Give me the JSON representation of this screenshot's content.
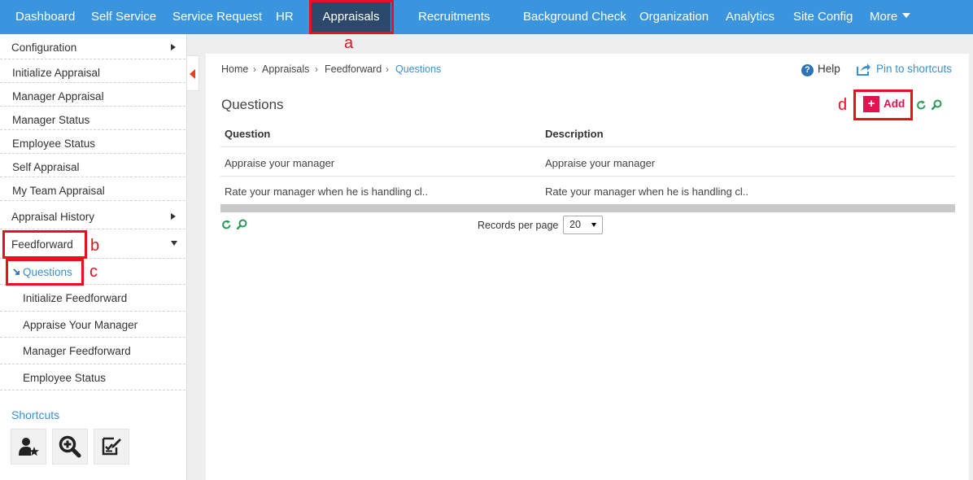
{
  "topnav": {
    "items": [
      "Dashboard",
      "Self Service",
      "Service Request",
      "HR",
      "Appraisals",
      "Recruitments",
      "Background Check",
      "Organization",
      "Analytics",
      "Site Config",
      "More"
    ],
    "active": "Appraisals"
  },
  "annotations": {
    "a": "a",
    "b": "b",
    "c": "c",
    "d": "d"
  },
  "sidebar": {
    "configuration": "Configuration",
    "items": [
      "Initialize Appraisal",
      "Manager Appraisal",
      "Manager Status",
      "Employee Status",
      "Self Appraisal",
      "My Team Appraisal"
    ],
    "appraisal_history": "Appraisal History",
    "feedforward": "Feedforward",
    "feedforward_sub": [
      "Questions",
      "Initialize Feedforward",
      "Appraise Your Manager",
      "Manager Feedforward",
      "Employee Status"
    ],
    "shortcuts_title": "Shortcuts",
    "shortcut_icons": [
      "user-star-icon",
      "zoom-in-icon",
      "checklist-edit-icon"
    ]
  },
  "breadcrumb": [
    "Home",
    "Appraisals",
    "Feedforward",
    "Questions"
  ],
  "toolbar": {
    "help": "Help",
    "pin": "Pin to shortcuts"
  },
  "page": {
    "title": "Questions",
    "add_label": "Add"
  },
  "table": {
    "headers": [
      "Question",
      "Description"
    ],
    "rows": [
      [
        "Appraise your manager",
        "Appraise your manager"
      ],
      [
        "Rate your manager when he is handling cl..",
        "Rate your manager when he is handling cl.."
      ]
    ]
  },
  "pagination": {
    "records_label": "Records per page",
    "records_value": "20"
  },
  "colors": {
    "nav_bg": "#3a95de",
    "nav_active": "#2b4a6b",
    "accent": "#e3134f",
    "link": "#3a8fd0",
    "annotation": "#e8101c"
  }
}
